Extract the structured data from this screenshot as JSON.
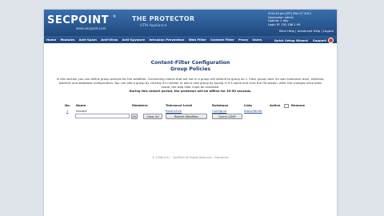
{
  "header": {
    "logo": "SECPOINT",
    "logo_tm": "®",
    "logo_sub": "www.secpoint.com",
    "product_title": "THE PROTECTOR",
    "product_sub": "UTM Appliance",
    "status_lines": [
      "4:04:45 pm [IST] Mar 27 2011",
      "Username: admin",
      "Uptime: 1 day",
      "Login IP: 192.168.1.99"
    ],
    "links": [
      "Main Help",
      "Advanced Help",
      "Logout"
    ]
  },
  "nav": {
    "items": [
      "Home",
      "Modules",
      "Anti-Spam",
      "Anti-Virus",
      "Anti-Spyware",
      "Intrusion Prevention",
      "Web Filter",
      "Content Filter",
      "Proxy",
      "Users"
    ],
    "right_items": [
      "Quick Setup Wizard",
      "Support"
    ]
  },
  "page": {
    "title_line1": "Content-Filter Configuration",
    "title_line2": "Group Policies",
    "intro": "In this section you can define group policies for the webfilter. Connecting clients that are not in a group will default to group no 1. Each group have it's own tolerance level, whitelist, blacklist and database configuration. You can add a group by clicking it's number or add a new group by typing in it's name and click the OK button. After the changes have been made, the web filter must be restarted.",
    "intro_bold": "During this restart period, the protector will be offline for 30-50 seconds.",
    "footer": "© 1998-2011 - SecPoint All Rights Reserved - Disclaimer"
  },
  "table": {
    "headers": {
      "no": "No.",
      "name": "Name",
      "members": "Members",
      "tolerance": "Tolerance Level",
      "database": "Database",
      "lists": "Lists",
      "active": "Active",
      "remove": "Remove"
    },
    "rows": [
      {
        "no": "1",
        "name": "Group1",
        "members": "",
        "tolerance": "Restrictive",
        "database": "Configure",
        "lists": "Black/White"
      }
    ],
    "new_group_value": "",
    "buttons": {
      "ok": "OK",
      "clear_all": "Clear All",
      "restart": "Restart Webfilter",
      "query_ldap": "Query LDAP"
    }
  },
  "colors": {
    "header_top": "#3a6fae",
    "header_bottom": "#20487c",
    "title": "#1d3a6b",
    "link": "#1f4f9d"
  }
}
